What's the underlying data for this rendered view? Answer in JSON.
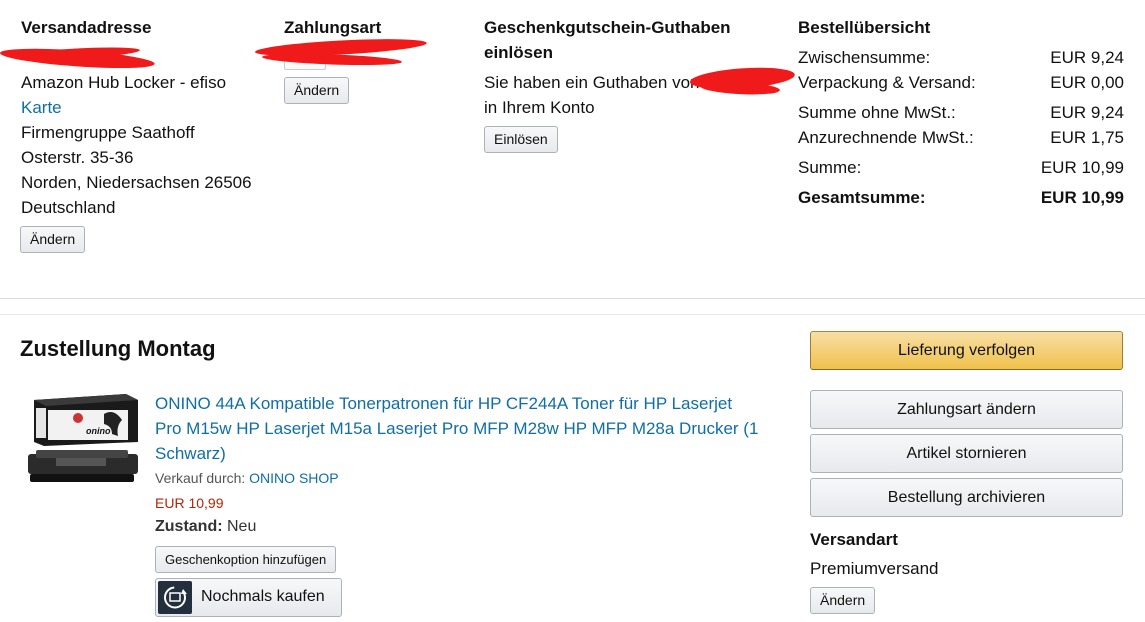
{
  "shipping": {
    "heading": "Versandadresse",
    "line1": "Amazon Hub Locker - efiso",
    "link": "Karte",
    "line2": "Firmengruppe Saathoff",
    "line3": "Osterstr. 35-36",
    "line4": "Norden, Niedersachsen 26506",
    "line5": "Deutschland",
    "change_label": "Ändern"
  },
  "payment": {
    "heading": "Zahlungsart",
    "change_label": "Ändern"
  },
  "giftcard": {
    "heading_line1": "Geschenkgutschein-Guthaben",
    "heading_line2": "einlösen",
    "text_line1": "Sie haben ein Guthaben von",
    "text_line2": "in Ihrem Konto",
    "redeem_label": "Einlösen"
  },
  "summary": {
    "heading": "Bestellübersicht",
    "rows": [
      {
        "label": "Zwischensumme:",
        "value": "EUR 9,24"
      },
      {
        "label": "Verpackung & Versand:",
        "value": "EUR 0,00"
      },
      {
        "label": "Summe ohne MwSt.:",
        "value": "EUR 9,24"
      },
      {
        "label": "Anzurechnende MwSt.:",
        "value": "EUR 1,75"
      },
      {
        "label": "Summe:",
        "value": "EUR 10,99"
      },
      {
        "label": "Gesamtsumme:",
        "value": "EUR 10,99"
      }
    ]
  },
  "delivery": {
    "heading": "Zustellung Montag",
    "product": {
      "title_line1": "ONINO 44A Kompatible Tonerpatronen für HP CF244A Toner für HP Laserjet",
      "title_line2": "Pro M15w HP Laserjet M15a Laserjet Pro MFP M28w HP MFP M28a Drucker (1",
      "title_line3": "Schwarz)",
      "seller_prefix": "Verkauf durch: ",
      "seller_name": "ONINO SHOP",
      "price": "EUR 10,99",
      "condition_label": "Zustand:",
      "condition_value": "Neu",
      "gift_label": "Geschenkoption hinzufügen",
      "buy_again_label": "Nochmals kaufen",
      "brand_text": "onino"
    }
  },
  "actions": {
    "track": "Lieferung verfolgen",
    "change_payment": "Zahlungsart ändern",
    "cancel": "Artikel stornieren",
    "archive": "Bestellung archivieren"
  },
  "shipping_method": {
    "heading": "Versandart",
    "value": "Premiumversand",
    "change_label": "Ändern"
  },
  "colors": {
    "link": "#0f6ea8",
    "price": "#b12704",
    "primary_button": "#f0c14b",
    "redaction": "#f01a1a"
  }
}
